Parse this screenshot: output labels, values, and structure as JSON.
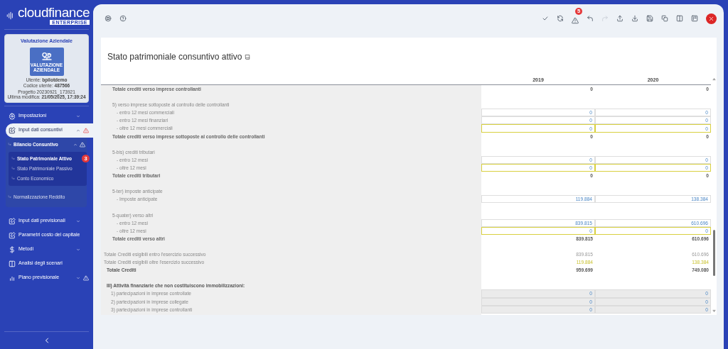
{
  "logo": {
    "wordmark": "**cloud**finance",
    "tagline": "ENTERPRISE"
  },
  "profile": {
    "title": "Valutazione Aziendale",
    "tile_label": "VALUTAZIONE AZIENDALE",
    "lines": [
      "Utente: **bpilotdemo**",
      "Codice utente: **487566**"
    ],
    "meta": [
      "Progetto 20230921_173921",
      "Ultima modifica: **21/05/2025, 17:39:24**"
    ]
  },
  "nav": [
    {
      "label": "Impostazioni",
      "kind": "group",
      "expanded": false,
      "selected": false,
      "alert": false
    },
    {
      "label": "Input dati consuntivi",
      "kind": "group",
      "expanded": true,
      "selected": true,
      "alert": true,
      "children": [
        {
          "label": "Bilancio Consuntivo",
          "kind": "group",
          "expanded": true,
          "alert": true,
          "children": [
            {
              "label": "Stato Patrimoniale Attivo",
              "selected": true,
              "badge": "3"
            },
            {
              "label": "Stato Patrimoniale Passivo",
              "selected": false
            },
            {
              "label": "Conto Economico",
              "selected": false
            }
          ]
        },
        {
          "label": "Normalizzazione Reddito",
          "kind": "link",
          "alert": false
        }
      ]
    },
    {
      "label": "Input dati previsionali",
      "kind": "group",
      "expanded": false,
      "selected": false,
      "alert": false
    },
    {
      "label": "Parametri costo del capitale",
      "kind": "link",
      "selected": false,
      "alert": false
    },
    {
      "label": "Metodi",
      "kind": "group",
      "expanded": false,
      "selected": false,
      "alert": false
    },
    {
      "label": "Analisi degli scenari",
      "kind": "link",
      "selected": false,
      "alert": false
    },
    {
      "label": "Piano previsionale",
      "kind": "group",
      "expanded": false,
      "selected": false,
      "alert": true
    }
  ],
  "toolbar": {
    "alerts_badge": "5",
    "redo": {
      "disabled": true
    }
  },
  "page": {
    "title": "Stato patrimoniale consuntivo attivo"
  },
  "table": {
    "columns": [
      "2019",
      "2020"
    ],
    "rows": [
      {
        "kind": "total",
        "gap_before": false,
        "label": "Totale crediti verso imprese controllanti",
        "values": [
          {
            "text": "0"
          },
          {
            "text": "0"
          }
        ]
      },
      {
        "kind": "section",
        "gap_before": true,
        "label": "5) verso imprese sottoposte al controllo delle controllanti"
      },
      {
        "kind": "input",
        "gap_before": false,
        "label": "- entro 12 mesi commerciali",
        "values": [
          {
            "text": "0",
            "warning": false
          },
          {
            "text": "0",
            "warning": false
          }
        ]
      },
      {
        "kind": "input",
        "gap_before": false,
        "label": "- entro 12 mesi finanziari",
        "values": [
          {
            "text": "0",
            "warning": false
          },
          {
            "text": "0",
            "warning": false
          }
        ]
      },
      {
        "kind": "input",
        "gap_before": false,
        "label": "- oltre 12 mesi commerciali",
        "values": [
          {
            "text": "0",
            "warning": true
          },
          {
            "text": "0",
            "warning": true
          }
        ]
      },
      {
        "kind": "total",
        "gap_before": false,
        "label": "Totale crediti verso imprese sottoposte al controllo delle controllanti",
        "values": [
          {
            "text": "0"
          },
          {
            "text": "0"
          }
        ]
      },
      {
        "kind": "section",
        "gap_before": true,
        "label": "5-bis) crediti tributari"
      },
      {
        "kind": "input",
        "gap_before": false,
        "label": "- entro 12 mesi",
        "values": [
          {
            "text": "0",
            "warning": false
          },
          {
            "text": "0",
            "warning": false
          }
        ]
      },
      {
        "kind": "input",
        "gap_before": false,
        "label": "- oltre 12 mesi",
        "values": [
          {
            "text": "0",
            "warning": true
          },
          {
            "text": "0",
            "warning": true
          }
        ]
      },
      {
        "kind": "total",
        "gap_before": false,
        "label": "Totale crediti tributari",
        "values": [
          {
            "text": "0"
          },
          {
            "text": "0"
          }
        ]
      },
      {
        "kind": "section",
        "gap_before": true,
        "label": "5-ter) imposte anticipate"
      },
      {
        "kind": "input",
        "gap_before": false,
        "label": "- Imposte anticipate",
        "values": [
          {
            "text": "119.884",
            "warning": false
          },
          {
            "text": "138.384",
            "warning": false
          }
        ]
      },
      {
        "kind": "section",
        "gap_before": true,
        "label": "5-quater) verso altri"
      },
      {
        "kind": "input",
        "gap_before": false,
        "label": "- entro 12 mesi",
        "values": [
          {
            "text": "839.815",
            "warning": false
          },
          {
            "text": "610.696",
            "warning": false
          }
        ]
      },
      {
        "kind": "input",
        "gap_before": false,
        "label": "- oltre 12 mesi",
        "values": [
          {
            "text": "0",
            "warning": true
          },
          {
            "text": "0",
            "warning": true
          }
        ]
      },
      {
        "kind": "total",
        "gap_before": false,
        "label": "Totale crediti verso altri",
        "values": [
          {
            "text": "839.815"
          },
          {
            "text": "610.696"
          }
        ]
      },
      {
        "kind": "sum",
        "gap_before": true,
        "label": "Totale Crediti esigibili entro l'esercizio successivo",
        "values": [
          {
            "text": "839.815",
            "warning": false
          },
          {
            "text": "610.696",
            "warning": false
          }
        ]
      },
      {
        "kind": "sum",
        "gap_before": false,
        "label": "Totale Crediti esigibili oltre l'esercizio successivo",
        "values": [
          {
            "text": "119.884",
            "warning": true
          },
          {
            "text": "138.384",
            "warning": true
          }
        ]
      },
      {
        "kind": "grand_total",
        "gap_before": false,
        "label": "Totale Crediti",
        "values": [
          {
            "text": "959.699"
          },
          {
            "text": "749.080"
          }
        ]
      },
      {
        "kind": "group",
        "gap_before": true,
        "label": "III) Attività finanziarie che non costituiscono immobilizzazioni:"
      },
      {
        "kind": "fixed",
        "gap_before": false,
        "label": "1) partecipazioni in imprese controllate",
        "values": [
          {
            "text": "0"
          },
          {
            "text": "0"
          }
        ]
      },
      {
        "kind": "fixed",
        "gap_before": false,
        "label": "2) partecipazioni in imprese collegate",
        "values": [
          {
            "text": "0"
          },
          {
            "text": "0"
          }
        ]
      },
      {
        "kind": "fixed",
        "gap_before": false,
        "label": "3) partecipazioni in imprese controllanti",
        "values": [
          {
            "text": "0"
          },
          {
            "text": "0"
          }
        ]
      }
    ]
  }
}
